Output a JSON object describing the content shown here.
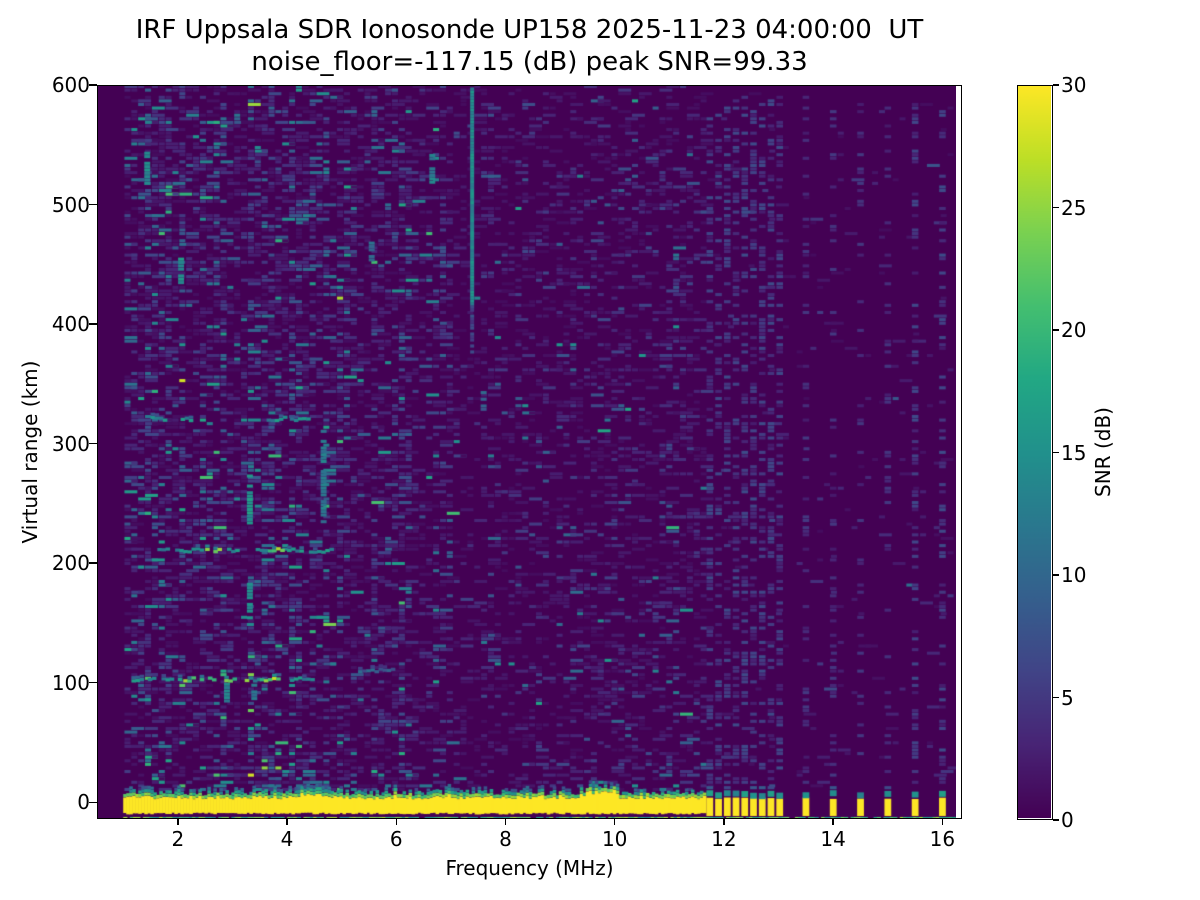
{
  "chart_data": {
    "type": "heatmap",
    "title": "IRF Uppsala SDR Ionosonde UP158 2025-11-23 04:00:00  UT",
    "subtitle": "noise_floor=-117.15 (dB) peak SNR=99.33",
    "station": "UP158",
    "timestamp_ut": "2025-11-23 04:00:00",
    "noise_floor_db": -117.15,
    "peak_snr_db": 99.33,
    "xlabel": "Frequency (MHz)",
    "ylabel": "Virtual range (km)",
    "xlim": [
      0.52,
      16.36
    ],
    "ylim": [
      -14,
      600
    ],
    "data_fmin": 1.0,
    "data_fmax": 16.25,
    "xticks": [
      2,
      4,
      6,
      8,
      10,
      12,
      14,
      16
    ],
    "yticks": [
      0,
      100,
      200,
      300,
      400,
      500,
      600
    ],
    "colorbar": {
      "label": "SNR (dB)",
      "min": 0,
      "max": 30,
      "ticks": [
        0,
        5,
        10,
        15,
        20,
        25,
        30
      ]
    },
    "colormap": {
      "name": "viridis",
      "stops": [
        "#440154",
        "#482475",
        "#414487",
        "#355f8d",
        "#2a788e",
        "#21918c",
        "#22a884",
        "#44bf70",
        "#7ad151",
        "#bddf26",
        "#fde725"
      ]
    },
    "background_value_db": 0,
    "noise": {
      "seed": 1337,
      "cell_w_mhz": 0.1256,
      "cell_h_km": 3.0,
      "regions": [
        {
          "f": [
            1.0,
            6.3
          ],
          "p": 0.6,
          "tau": 2.3,
          "teal_p": 0.045
        },
        {
          "f": [
            6.3,
            11.65
          ],
          "p": 0.4,
          "tau": 1.7,
          "teal_p": 0.012
        },
        {
          "f": [
            11.65,
            16.25
          ],
          "p": 0.06,
          "tau": 1.2,
          "teal_p": 0.0
        }
      ],
      "hot_columns": [
        {
          "f": 1.45,
          "g": 2.0
        },
        {
          "f": 1.75,
          "g": 1.6
        },
        {
          "f": 2.06,
          "g": 1.8
        },
        {
          "f": 2.5,
          "g": 1.6
        },
        {
          "f": 2.9,
          "g": 1.9
        },
        {
          "f": 3.32,
          "g": 2.2
        },
        {
          "f": 3.62,
          "g": 1.5
        },
        {
          "f": 4.1,
          "g": 1.6
        },
        {
          "f": 4.67,
          "g": 1.9
        },
        {
          "f": 5.0,
          "g": 1.7
        },
        {
          "f": 5.55,
          "g": 1.5
        },
        {
          "f": 6.1,
          "g": 1.4
        },
        {
          "f": 6.66,
          "g": 1.5
        },
        {
          "f": 7.0,
          "g": 1.3
        },
        {
          "f": 7.75,
          "g": 1.3
        },
        {
          "f": 8.4,
          "g": 1.35
        },
        {
          "f": 9.0,
          "g": 1.3
        },
        {
          "f": 9.65,
          "g": 1.4
        },
        {
          "f": 10.3,
          "g": 1.3
        },
        {
          "f": 10.9,
          "g": 1.3
        },
        {
          "f": 11.3,
          "g": 1.35
        }
      ],
      "bottom_boost": {
        "below_km": 35,
        "gain": 1.65
      }
    },
    "features": {
      "ground_band": {
        "f_start": 1.0,
        "f_end": 11.63,
        "range_top_km": 4,
        "range_bottom_km": -10.2,
        "value_db": 30,
        "fringe_max_db": 26,
        "bumps": [
          {
            "f": [
              9.45,
              10.05
            ],
            "extra_km": 5
          },
          {
            "f": [
              4.2,
              4.65
            ],
            "extra_km": 2.5
          }
        ]
      },
      "bottom_edge_line": {
        "f_start": 1.0,
        "f_end": 16.25,
        "range_km": -12.3,
        "value_db": 20
      },
      "station_bars": {
        "freqs": [
          11.74,
          11.9,
          12.06,
          12.22,
          12.38,
          12.54,
          12.7,
          12.86,
          13.02,
          13.5,
          14.0,
          14.5,
          15.0,
          15.5,
          16.0
        ],
        "range_top_km": 2.5,
        "range_bottom_km": -11.5,
        "value_db": 30,
        "tip_value_db": 15
      },
      "rfi_columns": [
        {
          "freqs": [
            11.74,
            11.9,
            12.06,
            12.22,
            12.38,
            12.54,
            12.7,
            12.86,
            13.02
          ],
          "density": 0.38,
          "value_db": [
            2,
            7
          ]
        },
        {
          "freqs": [
            13.5,
            14.0,
            14.5,
            15.0
          ],
          "density": 0.2,
          "value_db": [
            2,
            5
          ]
        },
        {
          "freqs": [
            15.5,
            16.0
          ],
          "density": 0.34,
          "value_db": [
            2,
            7
          ]
        }
      ],
      "vertical_line": {
        "f": 7.39,
        "range_start_km": 418,
        "range_end_km": 600,
        "value_db": 14,
        "fade": {
          "range_start_km": 378,
          "range_end_km": 418,
          "value_db": 6
        }
      },
      "echo_traces": [
        {
          "range_km": 104,
          "segments": [
            [
              1.15,
              1.55,
              "t"
            ],
            [
              1.7,
              2.05,
              "t"
            ],
            [
              2.1,
              2.3,
              "b"
            ],
            [
              2.4,
              2.75,
              "b"
            ],
            [
              2.85,
              3.25,
              "b"
            ],
            [
              3.3,
              3.45,
              "t"
            ],
            [
              3.5,
              3.95,
              "b"
            ],
            [
              4.05,
              4.45,
              "t"
            ]
          ]
        },
        {
          "range_km": 112,
          "segments": [
            [
              5.3,
              6.0,
              "f"
            ]
          ]
        },
        {
          "range_km": 212,
          "segments": [
            [
              1.55,
              1.9,
              "t"
            ],
            [
              1.95,
              2.45,
              "t"
            ],
            [
              2.5,
              2.8,
              "b"
            ],
            [
              2.9,
              3.1,
              "t"
            ],
            [
              3.35,
              3.6,
              "t"
            ],
            [
              3.65,
              3.95,
              "b"
            ],
            [
              4.0,
              4.3,
              "t"
            ],
            [
              4.4,
              4.78,
              "t"
            ]
          ]
        },
        {
          "range_km": 322,
          "segments": [
            [
              1.5,
              1.78,
              "t"
            ],
            [
              2.05,
              2.32,
              "t"
            ],
            [
              3.55,
              4.0,
              "t"
            ],
            [
              4.05,
              4.5,
              "t"
            ]
          ]
        }
      ],
      "teal_dashes": [
        {
          "f": 3.32,
          "r0": 150,
          "r1": 185,
          "v": 15
        },
        {
          "f": 3.32,
          "r0": 235,
          "r1": 275,
          "v": 16
        },
        {
          "f": 4.67,
          "r0": 236,
          "r1": 312,
          "v": 12
        },
        {
          "f": 2.06,
          "r0": 436,
          "r1": 462,
          "v": 15
        },
        {
          "f": 1.44,
          "r0": 519,
          "r1": 545,
          "v": 14
        },
        {
          "f": 6.66,
          "r0": 520,
          "r1": 548,
          "v": 13
        },
        {
          "f": 2.9,
          "r0": 86,
          "r1": 102,
          "v": 13
        },
        {
          "f": 3.4,
          "r0": 88,
          "r1": 100,
          "v": 12
        },
        {
          "f": 5.55,
          "r0": 455,
          "r1": 470,
          "v": 10
        },
        {
          "f": 7.6,
          "r0": 330,
          "r1": 345,
          "v": 9
        }
      ]
    }
  }
}
